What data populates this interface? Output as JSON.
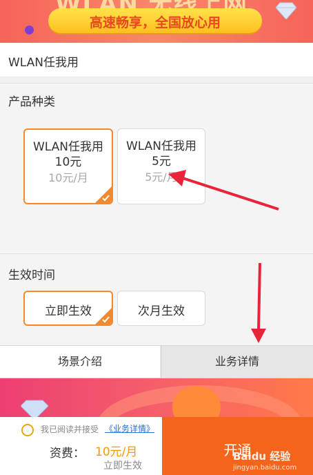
{
  "banner": {
    "headline": "WLAN 无线上网",
    "slogan": "高速畅享，全国放心用"
  },
  "page_title": "WLAN任我用",
  "product": {
    "label": "产品种类",
    "cards": [
      {
        "name": "WLAN任我用",
        "amount": "10元",
        "price": "10元/月",
        "selected": true
      },
      {
        "name": "WLAN任我用",
        "amount": "5元",
        "price": "5元/月",
        "selected": false
      }
    ]
  },
  "effective": {
    "label": "生效时间",
    "options": [
      {
        "label": "立即生效",
        "selected": true
      },
      {
        "label": "次月生效",
        "selected": false
      }
    ]
  },
  "tabs": [
    "场景介绍",
    "业务详情"
  ],
  "footer": {
    "agree_text": "我已阅读并接受",
    "agree_link": "《业务详情》",
    "fee_label": "资费：",
    "fee_value": "10元/月",
    "fee_sub": "立即生效",
    "open_button": "开通"
  },
  "watermark": {
    "main": "Baidu 经验",
    "sub": "jingyan.baidu.com"
  },
  "colors": {
    "accent": "#f08a2c",
    "open_button": "#f5641b",
    "fee": "#f29a00",
    "annotation_arrow": "#e8243a"
  }
}
